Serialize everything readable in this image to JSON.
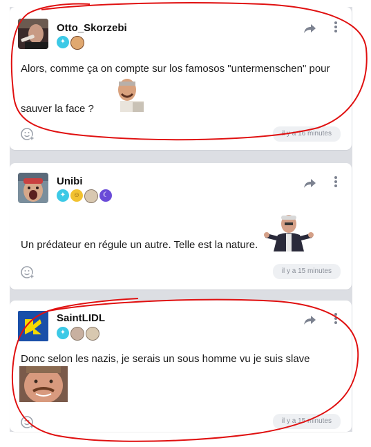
{
  "posts": [
    {
      "username": "Otto_Skorzebi",
      "text_line1": "Alors, comme ça on compte sur los famosos \"untermenschen\" pour",
      "text_line2": "sauver la face ?",
      "timestamp": "il y a 16 minutes",
      "badge_icons": [
        "diamond-badge",
        "avatar-badge"
      ]
    },
    {
      "username": "Unibi",
      "text_line1": "Un prédateur en régule un autre. Telle est la nature.",
      "timestamp": "il y a 15 minutes",
      "badge_icons": [
        "diamond-badge",
        "emoji-badge",
        "face-badge",
        "moon-badge"
      ]
    },
    {
      "username": "SaintLIDL",
      "text_line1": "Donc selon les nazis, je serais un sous homme vu je suis slave",
      "timestamp": "il y a 15 minutes",
      "badge_icons": [
        "diamond-badge",
        "face-badge",
        "face-badge"
      ]
    }
  ],
  "colors": {
    "accent_cyan": "#3cc9e6",
    "annotation_red": "#e01010",
    "timestamp_bg": "#eef0f3",
    "feed_bg": "#dcdee3"
  },
  "icons": {
    "share": "share-arrow-icon",
    "more": "vertical-dots-icon",
    "react": "add-emoji-icon"
  }
}
